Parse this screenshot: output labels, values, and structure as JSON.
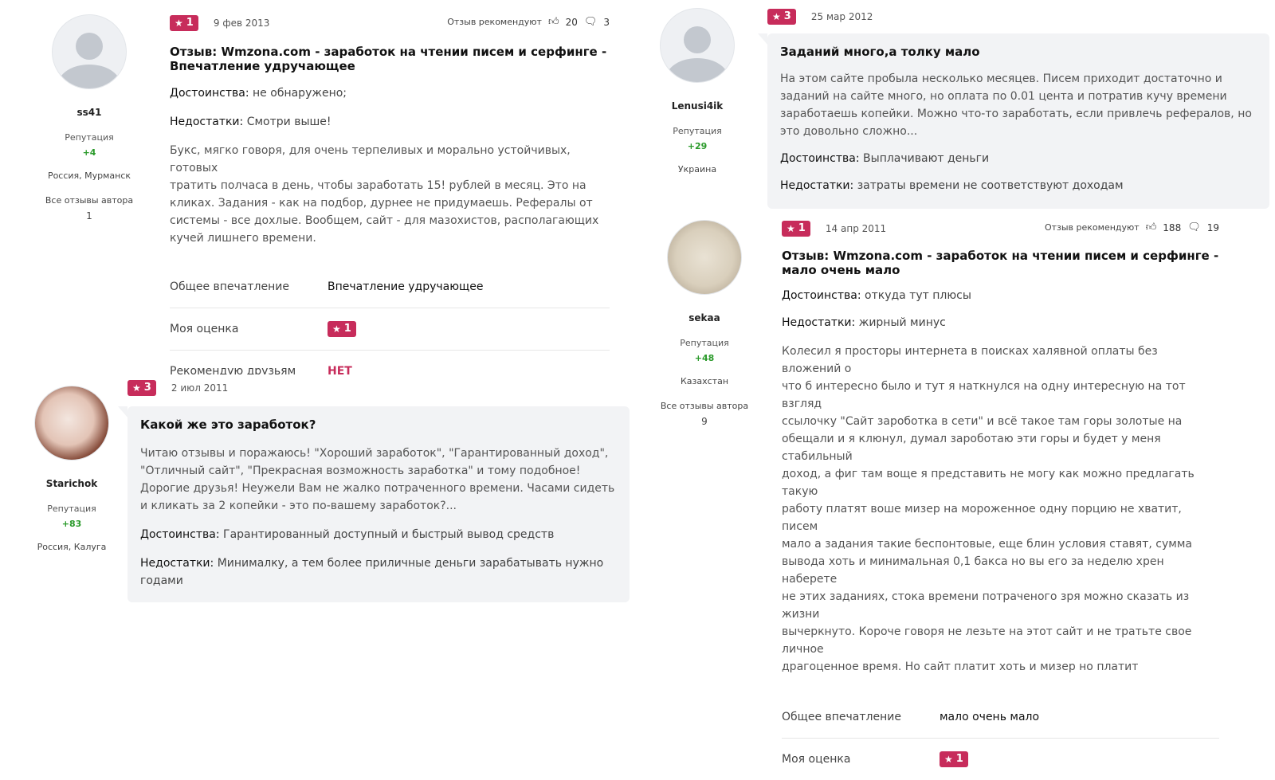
{
  "reviews": [
    {
      "id": "r1",
      "author": {
        "name": "ss41",
        "reputation_label": "Репутация",
        "reputation": "+4",
        "location": "Россия, Мурманск",
        "all_reviews_label": "Все отзывы автора",
        "all_reviews_count": "1"
      },
      "rating": "1",
      "date": "9 фев 2013",
      "recommend_label": "Отзыв рекомендуют",
      "likes": "20",
      "comments": "3",
      "title_line1": "Отзыв: Wmzona.com - заработок на чтении писем и серфинге -",
      "title_line2": "Впечатление удручающее",
      "pros_label": "Достоинства:",
      "pros": "не обнаружено;",
      "cons_label": "Недостатки:",
      "cons": "Смотри выше!",
      "text_lines": [
        "Букс, мягко говоря, для очень терпеливых и морально устойчивых, готовых",
        "тратить полчаса в день, чтобы заработать 15! рублей в месяц. Это на",
        "кликах. Задания - как на подбор, дурнее не придумаешь. Рефералы от",
        "системы - все дохлые. Вообщем, сайт - для мазохистов, располагающих",
        "кучей лишнего времени."
      ],
      "summary": {
        "impression_label": "Общее впечатление",
        "impression": "Впечатление удручающее",
        "rating_label": "Моя оценка",
        "rating": "1",
        "recommend_label": "Рекомендую друзьям",
        "recommend": "НЕТ"
      }
    },
    {
      "id": "r2",
      "author": {
        "name": "Starichok",
        "reputation_label": "Репутация",
        "reputation": "+83",
        "location": "Россия, Калуга"
      },
      "rating": "3",
      "date": "2 июл 2011",
      "title": "Какой же это заработок?",
      "text_lines": [
        "Читаю отзывы и поражаюсь! \"Хороший заработок\", \"Гарантированный доход\",",
        "\"Отличный сайт\", \"Прекрасная возможность заработка\" и тому подобное!",
        "Дорогие друзья! Неужели Вам не жалко потраченного времени. Часами сидеть",
        "и кликать за 2 копейки - это по-вашему заработок?..."
      ],
      "pros_label": "Достоинства:",
      "pros": "Гарантированный доступный и быстрый вывод средств",
      "cons_label": "Недостатки:",
      "cons_line1": "Минималку, а тем более приличные деньги зарабатывать нужно",
      "cons_line2": "годами"
    },
    {
      "id": "r3",
      "author": {
        "name": "Lenusi4ik",
        "reputation_label": "Репутация",
        "reputation": "+29",
        "location": "Украина"
      },
      "rating": "3",
      "date": "25 мар 2012",
      "title": "Заданий много,а толку мало",
      "text_lines": [
        "На этом сайте пробыла несколько месяцев. Писем приходит достаточно и",
        "заданий на сайте много, но оплата по 0.01 цента и потратив кучу времени",
        "заработаешь копейки. Можно что-то заработать, если привлечь рефералов, но",
        "это довольно сложно..."
      ],
      "pros_label": "Достоинства:",
      "pros": "Выплачивают деньги",
      "cons_label": "Недостатки:",
      "cons": "затраты времени не соответствуют доходам"
    },
    {
      "id": "r4",
      "author": {
        "name": "sekaa",
        "reputation_label": "Репутация",
        "reputation": "+48",
        "location": "Казахстан",
        "all_reviews_label": "Все отзывы автора",
        "all_reviews_count": "9"
      },
      "rating": "1",
      "date": "14 апр 2011",
      "recommend_label": "Отзыв рекомендуют",
      "likes": "188",
      "comments": "19",
      "title_line1": "Отзыв: Wmzona.com - заработок на чтении писем и серфинге -",
      "title_line2": "мало очень мало",
      "pros_label": "Достоинства:",
      "pros": "откуда тут плюсы",
      "cons_label": "Недостатки:",
      "cons": "жирный минус",
      "text_lines": [
        "Колесил я просторы интернета в поисках халявной оплаты без вложений о",
        "что б интересно было и тут я наткнулся на одну интересную на тот взгляд",
        "ссылочку \"Сайт зароботка в сети\" и всё такое там горы золотые на",
        "обещали и я клюнул, думал зароботаю эти горы и будет у меня стабильный",
        "доход, а фиг там воще я представить не могу как можно предлагать такую",
        "работу платят воше мизер на мороженное одну порцию не хватит, писем",
        "мало а задания такие беспонтовые, еще блин условия ставят, сумма",
        "вывода хоть и минимальная 0,1 бакса но вы его за неделю хрен наберете",
        "не этих заданиях, стока времени потраченого зря можно сказать из жизни",
        "вычеркнуто. Короче говоря не лезьте на этот сайт и не тратьте свое личное",
        "драгоценное время. Но сайт платит хоть и мизер но платит"
      ],
      "summary": {
        "impression_label": "Общее впечатление",
        "impression": "мало очень мало",
        "rating_label": "Моя оценка",
        "rating": "1"
      }
    }
  ],
  "icons": {
    "star": "star-icon",
    "like": "thumbs-up-icon",
    "comment": "comment-bubble-icon"
  },
  "colors": {
    "badge": "#c72c5b",
    "reputation": "#2a9a2a",
    "bubble": "#f2f3f5"
  }
}
